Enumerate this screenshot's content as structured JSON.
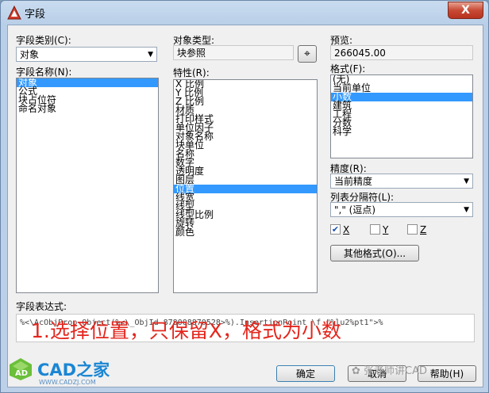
{
  "window": {
    "title": "字段",
    "close_label": "X"
  },
  "field_category": {
    "label": "字段类别(C):",
    "value": "对象"
  },
  "field_names": {
    "label": "字段名称(N):",
    "items": [
      "对象",
      "公式",
      "块占位符",
      "命名对象"
    ],
    "selected_index": 0
  },
  "object_type": {
    "label": "对象类型:",
    "value": "块参照"
  },
  "properties": {
    "label": "特性(R):",
    "items": [
      "X 比例",
      "Y 比例",
      "Z 比例",
      "材质",
      "打印样式",
      "单位因子",
      "对象名称",
      "块单位",
      "名称",
      "数字",
      "透明度",
      "图层",
      "位置",
      "线宽",
      "线型",
      "线型比例",
      "旋转",
      "颜色"
    ],
    "selected_index": 12
  },
  "preview": {
    "label": "预览:",
    "value": "266045.00"
  },
  "format": {
    "label": "格式(F):",
    "items": [
      "(无)",
      "当前单位",
      "小数",
      "建筑",
      "工程",
      "分数",
      "科学"
    ],
    "selected_index": 2
  },
  "precision": {
    "label": "精度(R):",
    "value": "当前精度"
  },
  "list_separator": {
    "label": "列表分隔符(L):",
    "value": "\",\" (逗点)"
  },
  "checkboxes": [
    {
      "label": "X",
      "checked": true
    },
    {
      "label": "Y",
      "checked": false
    },
    {
      "label": "Z",
      "checked": false
    }
  ],
  "other_format_button": "其他格式(O)...",
  "field_expression": {
    "label": "字段表达式:",
    "value": "%<\\AcObjProp Object(%<\\_ObjId 878008870528>%).InsertionPoint \\f \"%lu2%pt1\">%"
  },
  "annotation": "1.选择位置，只保留X，格式为小数",
  "buttons": {
    "ok": "确定",
    "cancel": "取消",
    "help": "帮助(H)"
  },
  "logo": {
    "name": "CAD之家",
    "url": "WWW.CADZJ.COM"
  },
  "watermark": "✿ 张老师讲CAD",
  "colors": {
    "selection": "#3399ff",
    "annotation": "#e3261d",
    "close": "#c74a35"
  }
}
